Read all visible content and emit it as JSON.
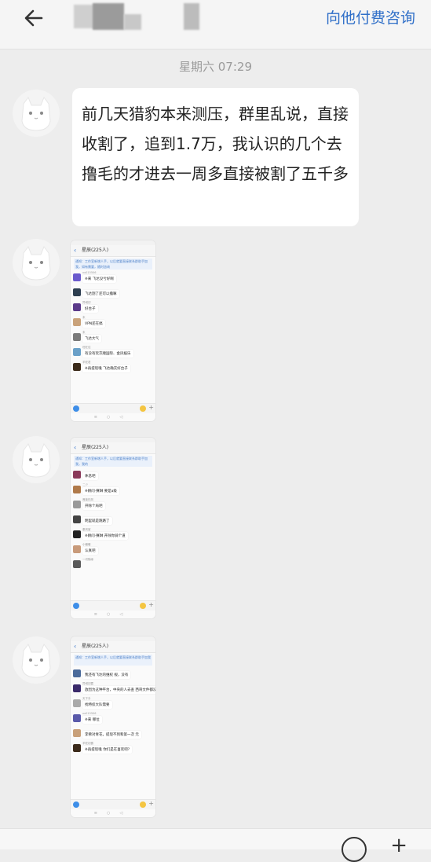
{
  "header": {
    "consult_label": "向他付费咨询"
  },
  "timestamp": "星期六 07:29",
  "message_text": "前几天猎豹本来测压，群里乱说，直接收割了，追到1.7万，我认识的几个去撸毛的才进去一周多直接被割了五千多",
  "shots": [
    {
      "title": "星辰(225人)",
      "notice": "通知：工作室新增人手，以后就要直接联系群助手加我，如有需要，随时咨询",
      "messages": [
        {
          "name": "xx015506",
          "text": "※来 飞达没亏好啊",
          "color": "#6a5acd"
        },
        {
          "name": "",
          "text": "飞达割了还可以撸嘛",
          "color": "#2d3e50"
        },
        {
          "name": "异域初",
          "text": "好台子",
          "color": "#5b3a8a"
        },
        {
          "name": "未",
          "text": "VPN还在搞",
          "color": "#c9a27a"
        },
        {
          "name": "未",
          "text": "飞达大气",
          "color": "#7a7a7a"
        },
        {
          "name": "旺旺佳",
          "text": "有没有玩京顺国际、金凤娱乐",
          "color": "#6aa0c8"
        },
        {
          "name": "羊驼君",
          "text": "※再提现嗓 飞达确实好台子",
          "color": "#3b2a1a"
        }
      ]
    },
    {
      "title": "星辰(225人)",
      "notice": "通知：工作室新增人手，以后就要直接联系群助手加我，我的",
      "messages": [
        {
          "name": "",
          "text": "休息吧",
          "color": "#8a3a5a"
        },
        {
          "name": "二少",
          "text": "※顾问·赛琳 要是a级",
          "color": "#b07a4a"
        },
        {
          "name": "蓬莱的风",
          "text": "开除个局吧",
          "color": "#999999"
        },
        {
          "name": "",
          "text": "明里就是跑路了",
          "color": "#444444"
        },
        {
          "name": "秦风客",
          "text": "※顾问·赛琳 开除你骑个道",
          "color": "#222222"
        },
        {
          "name": "小暖暖",
          "text": "认真吧",
          "color": "#c89a7a"
        },
        {
          "name": "一切随缘",
          "text": "",
          "color": "#5a5a5a"
        }
      ]
    },
    {
      "title": "星辰(225人)",
      "notice": "通知：工作室新增人手，以后就要直接联系群助手加我",
      "messages": [
        {
          "name": "",
          "text": "我还有飞达的维权 规，没有",
          "color": "#4a6a9a"
        },
        {
          "name": "异域初露",
          "text": "放因为这种平台，中央的人去查 西哥文件都没用",
          "color": "#3a2a6a"
        },
        {
          "name": "天下手",
          "text": "找特侦大队需要",
          "color": "#aaaaaa"
        },
        {
          "name": "xx015506",
          "text": "※来 哪位",
          "color": "#5a5aaa"
        },
        {
          "name": "",
          "text": "李佛对青花，提现不到和第一次 元",
          "color": "#c8a07a"
        },
        {
          "name": "羊驼初露",
          "text": "※再提现嗓 你们是在喜欢吧?",
          "color": "#3b2a1a"
        }
      ]
    }
  ]
}
